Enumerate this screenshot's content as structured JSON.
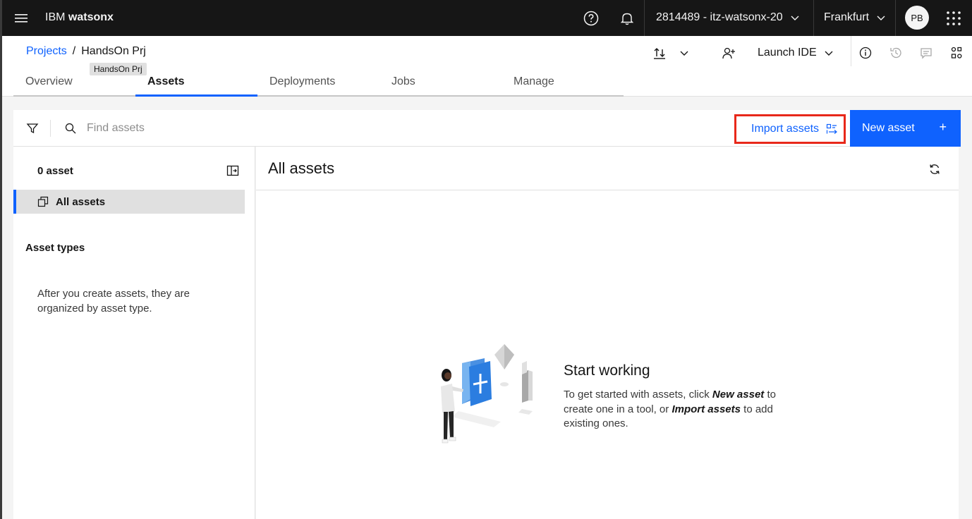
{
  "topbar": {
    "brand_prefix": "IBM",
    "brand_name": "watsonx",
    "account": "2814489 - itz-watsonx-20",
    "region": "Frankfurt",
    "avatar_initials": "PB"
  },
  "project": {
    "breadcrumb_root": "Projects",
    "breadcrumb_sep": "/",
    "name": "HandsOn Prj",
    "tooltip": "HandsOn Prj",
    "launch_ide": "Launch IDE"
  },
  "tabs": [
    {
      "label": "Overview",
      "active": false
    },
    {
      "label": "Assets",
      "active": true
    },
    {
      "label": "Deployments",
      "active": false
    },
    {
      "label": "Jobs",
      "active": false
    },
    {
      "label": "Manage",
      "active": false
    }
  ],
  "toolbar": {
    "search_placeholder": "Find assets",
    "import_label": "Import assets",
    "new_label": "New asset",
    "new_plus": "+"
  },
  "side": {
    "count_label": "0 asset",
    "all_assets": "All assets",
    "types_title": "Asset types",
    "types_empty": "After you create assets, they are organized by asset type."
  },
  "main": {
    "title": "All assets",
    "empty_title": "Start working",
    "desc_1": "To get started with assets, click ",
    "desc_new": "New asset",
    "desc_2": " to create one in a tool, or ",
    "desc_import": "Import assets",
    "desc_3": " to add existing ones."
  },
  "colors": {
    "accent": "#0f62fe",
    "topbar_bg": "#161616",
    "highlight_box": "#e8281a"
  }
}
